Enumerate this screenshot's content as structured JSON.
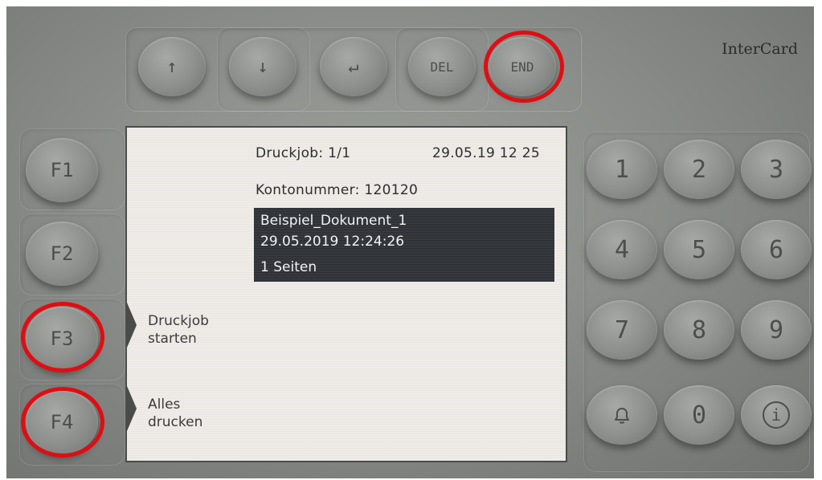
{
  "brand": "InterCard",
  "nav_keys": {
    "up": "↑",
    "down": "↓",
    "enter": "↵",
    "del": "DEL",
    "end": "END"
  },
  "function_keys": [
    "F1",
    "F2",
    "F3",
    "F4"
  ],
  "numpad": [
    "1",
    "2",
    "3",
    "4",
    "5",
    "6",
    "7",
    "8",
    "9",
    "0"
  ],
  "screen": {
    "job_counter": "Druckjob: 1/1",
    "datetime": "29.05.19 12 25",
    "account": "Kontonummer: 120120",
    "selected_job": {
      "name": "Beispiel_Dokument_1",
      "timestamp": "29.05.2019 12:24:26",
      "pages": "1 Seiten"
    },
    "softkeys": {
      "f3": [
        "Druckjob",
        "starten"
      ],
      "f4": [
        "Alles",
        "drucken"
      ]
    }
  },
  "highlight_color": "#e00d12"
}
